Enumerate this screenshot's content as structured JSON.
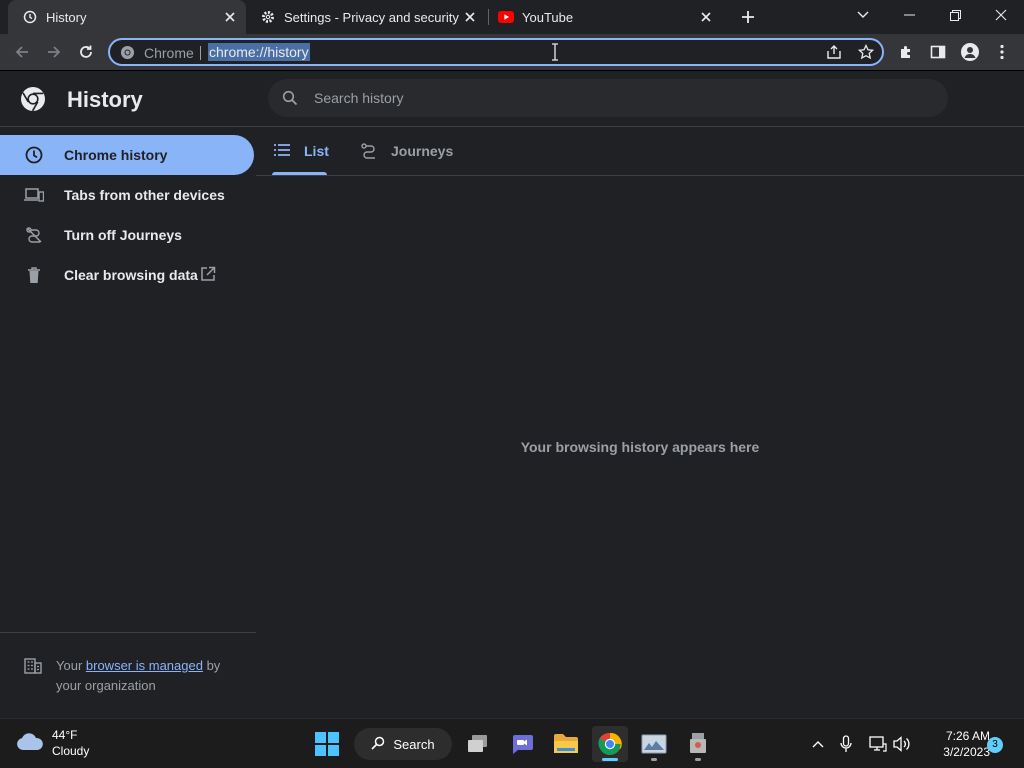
{
  "browser": {
    "tabs": [
      {
        "title": "History",
        "icon": "history-icon",
        "active": true
      },
      {
        "title": "Settings - Privacy and security",
        "icon": "gear-icon",
        "active": false
      },
      {
        "title": "YouTube",
        "icon": "youtube-icon",
        "active": false
      }
    ],
    "omnibox": {
      "site_label": "Chrome",
      "url": "chrome://history"
    }
  },
  "history": {
    "title": "History",
    "search": {
      "placeholder": "Search history"
    },
    "sidebar": {
      "items": [
        {
          "label": "Chrome history",
          "icon": "clock-icon",
          "selected": true
        },
        {
          "label": "Tabs from other devices",
          "icon": "devices-icon",
          "selected": false
        },
        {
          "label": "Turn off Journeys",
          "icon": "journeys-off-icon",
          "selected": false
        },
        {
          "label": "Clear browsing data",
          "icon": "trash-icon",
          "selected": false
        }
      ],
      "managed": {
        "prefix": "Your ",
        "link": "browser is managed",
        "suffix": " by your organization"
      }
    },
    "view_tabs": [
      {
        "label": "List",
        "icon": "list-icon",
        "active": true
      },
      {
        "label": "Journeys",
        "icon": "journeys-icon",
        "active": false
      }
    ],
    "empty_message": "Your browsing history appears here"
  },
  "taskbar": {
    "weather": {
      "temp": "44°F",
      "condition": "Cloudy"
    },
    "search_label": "Search",
    "clock": {
      "time": "7:26 AM",
      "date": "3/2/2023"
    },
    "notification_count": "3"
  },
  "colors": {
    "accent": "#8ab4f8",
    "background": "#202124",
    "toolbar": "#35363a"
  }
}
